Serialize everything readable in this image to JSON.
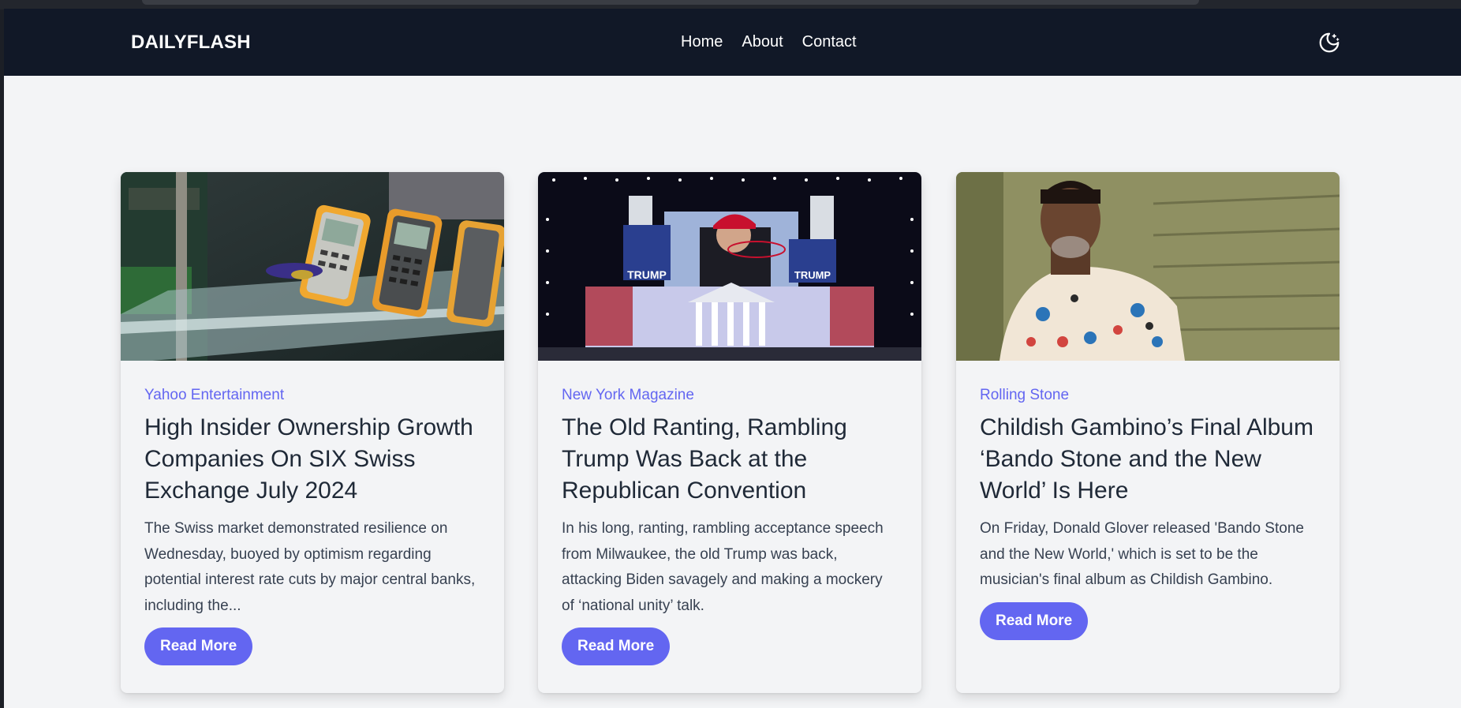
{
  "header": {
    "brand": "DAILYFLASH",
    "nav": [
      "Home",
      "About",
      "Contact"
    ],
    "theme_toggle_icon": "moon-stars-icon"
  },
  "articles": [
    {
      "source": "Yahoo Entertainment",
      "title": "High Insider Ownership Growth Companies On SIX Swiss Exchange July 2024",
      "excerpt": "The Swiss market demonstrated resilience on Wednesday, buoyed by optimism regarding potential interest rate cuts by major central banks, including the...",
      "button": "Read More"
    },
    {
      "source": "New York Magazine",
      "title": "The Old Ranting, Rambling Trump Was Back at the Republican Convention",
      "excerpt": "In his long, ranting, rambling acceptance speech from Milwaukee, the old Trump was back, attacking Biden savagely and making a mockery of ‘national unity’ talk.",
      "button": "Read More"
    },
    {
      "source": "Rolling Stone",
      "title": "Childish Gambino’s Final Album ‘Bando Stone and the New World’ Is Here",
      "excerpt": "On Friday, Donald Glover released 'Bando Stone and the New World,' which is set to be the musician's final album as Childish Gambino.",
      "button": "Read More"
    }
  ],
  "colors": {
    "nav_bg": "#111827",
    "page_bg": "#f3f4f6",
    "accent": "#6366f1",
    "title_text": "#1f2937",
    "body_text": "#374151"
  }
}
